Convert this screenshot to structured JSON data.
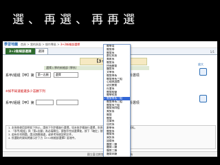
{
  "slide_title": "選、再選、再再選",
  "nav": {
    "logo": "學習地圖",
    "breadcrumb": [
      "首頁",
      "我的頁面",
      "操作專區",
      "3+2新細部選擇"
    ],
    "current": "3+2新細部選擇"
  },
  "tabs": [
    {
      "label": "3+2新細部選擇",
      "active": true
    },
    {
      "label": "選擇",
      "active": false
    }
  ],
  "pageno": "1/1",
  "form": {
    "title": "【3+2新細部選擇】",
    "header_label": "選擇入學的新細部 (學系)",
    "row1": {
      "label": "系甲/組組【甲】第",
      "select1": "第一志願",
      "select2": "選擇",
      "suffix": "類(名)系組別的新選項",
      "zoom": "放大"
    },
    "row2": {
      "label": "系甲/組組【甲】第",
      "select1": "",
      "select2": "",
      "suffix": "類(名)系組別的新選項",
      "note": "(搜尋"
    },
    "warning": "※如不知道能選多少志願下列"
  },
  "notice_lines": [
    "1. 本系統使用說明如下所示，請依下列步驟進行選擇，如未依步驟進行選擇，則系統不會儲存您所選擇的資料。",
    "2. 「系甲/組組」與「第x志願」為必填欄位，請依序完成選擇後，按下「確定」按鈕送出。",
    "3. 若有任何問題，請洽詢教務處，或參考系統說明文件。",
    "4. 所選取的資料將顯示於下方【3+2新細部選擇】區塊中。"
  ],
  "footer": "國立臺北教育大學 資訊中心 版權所有",
  "dropdown": {
    "items": [
      "教學用",
      "教育學",
      "教育系",
      "數位科技",
      "美術系",
      "教育系",
      "特殊教育",
      "體育系",
      "文學系",
      "教育學系",
      "教育學系三組",
      "心理與諮商",
      "幼兒教育",
      "社會系",
      "教育經營",
      "教學科技",
      "教育學系一組",
      "教育學系二組",
      "教育系三組",
      "教育系四組",
      "美勞系",
      "教育",
      "教育",
      "音樂系",
      "自然系",
      "數學系",
      "教育系",
      "教育系",
      "資訊系",
      "諮商系",
      "體育一類",
      "體育二類",
      "體育三類",
      "體育四類"
    ],
    "selected_index": 16
  }
}
